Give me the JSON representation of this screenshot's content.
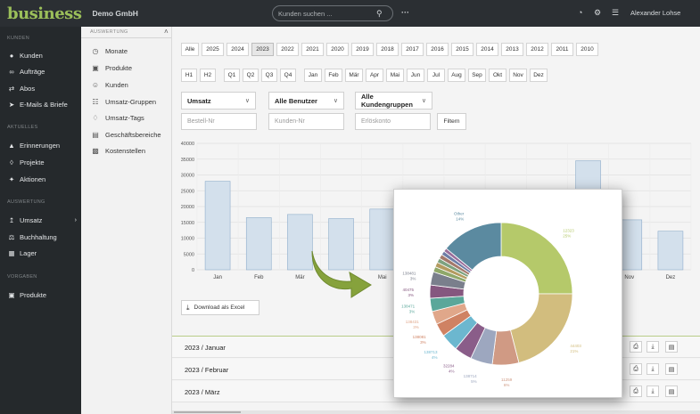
{
  "header": {
    "logo": "business",
    "company": "Demo GmbH",
    "search_placeholder": "Kunden suchen ...",
    "more": "···",
    "user": "Alexander Lohse"
  },
  "sidebar": {
    "sections": [
      {
        "title": "KUNDEN",
        "items": [
          "Kunden",
          "Aufträge",
          "Abos",
          "E-Mails & Briefe"
        ]
      },
      {
        "title": "AKTUELLES",
        "items": [
          "Erinnerungen",
          "Projekte",
          "Aktionen"
        ]
      },
      {
        "title": "AUSWERTUNG",
        "items": [
          "Umsatz",
          "Buchhaltung",
          "Lager"
        ]
      },
      {
        "title": "VORGABEN",
        "items": [
          "Produkte"
        ]
      }
    ]
  },
  "subnav": {
    "title": "AUSWERTUNG",
    "items": [
      "Monate",
      "Produkte",
      "Kunden",
      "Umsatz-Gruppen",
      "Umsatz-Tags",
      "Geschäftsbereiche",
      "Kostenstellen"
    ]
  },
  "years": [
    "Alle",
    "2025",
    "2024",
    "2023",
    "2022",
    "2021",
    "2020",
    "2019",
    "2018",
    "2017",
    "2016",
    "2015",
    "2014",
    "2013",
    "2012",
    "2011",
    "2010"
  ],
  "active_year": "2023",
  "periods": [
    "H1",
    "H2",
    "Q1",
    "Q2",
    "Q3",
    "Q4",
    "Jan",
    "Feb",
    "Mär",
    "Apr",
    "Mai",
    "Jun",
    "Jul",
    "Aug",
    "Sep",
    "Okt",
    "Nov",
    "Dez"
  ],
  "filters": {
    "metric": "Umsatz",
    "users": "Alle Benutzer",
    "groups": "Alle Kundengruppen",
    "order_placeholder": "Bestell-Nr",
    "customer_placeholder": "Kunden-Nr",
    "account_placeholder": "Erlöskonto",
    "filter_label": "Filtern"
  },
  "download_label": "Download als Excel",
  "month_rows": [
    "2023 / Januar",
    "2023 / Februar",
    "2023 / März"
  ],
  "chart_data": [
    {
      "type": "bar",
      "categories": [
        "Jan",
        "Feb",
        "Mär",
        "Apr",
        "Mai",
        "Jun",
        "Jul",
        "Aug",
        "Sep",
        "Okt",
        "Nov",
        "Dez"
      ],
      "category_labels": [
        "Jan",
        "Feb",
        "Mär",
        "",
        "Mai",
        "",
        "",
        "",
        "",
        "",
        "Nov",
        "Dez"
      ],
      "values": [
        28000,
        16500,
        17500,
        16200,
        19200,
        null,
        null,
        null,
        null,
        34500,
        15800,
        12200
      ],
      "ylim": [
        0,
        40000
      ],
      "yticks": [
        0,
        5000,
        10000,
        15000,
        20000,
        25000,
        30000,
        35000,
        40000
      ],
      "grid": true,
      "bar_color": "#d3e0ec",
      "bar_edge": "#8faecb"
    },
    {
      "type": "pie",
      "donut": true,
      "labeled_slices": [
        {
          "label": "12323",
          "pct": "25%",
          "value": 25,
          "color": "#b5c96a"
        },
        {
          "label": "44403",
          "pct": "21%",
          "value": 21,
          "color": "#d2bd7e"
        },
        {
          "label": "11259",
          "pct": "6%",
          "value": 6,
          "color": "#d09a84"
        },
        {
          "label": "138714",
          "pct": "5%",
          "value": 5,
          "color": "#9da7bf"
        },
        {
          "label": "32284",
          "pct": "4%",
          "value": 4,
          "color": "#8a5d89"
        },
        {
          "label": "138713",
          "pct": "4%",
          "value": 4,
          "color": "#6cb7cf"
        },
        {
          "label": "138081",
          "pct": "3%",
          "value": 3,
          "color": "#cf8263"
        },
        {
          "label": "138431",
          "pct": "3%",
          "value": 3,
          "color": "#e0a78a"
        },
        {
          "label": "138471",
          "pct": "3%",
          "value": 3,
          "color": "#5aa79a"
        },
        {
          "label": "40475",
          "pct": "3%",
          "value": 3,
          "color": "#85577f"
        },
        {
          "label": "138481",
          "pct": "3%",
          "value": 3,
          "color": "#7a7f8c"
        },
        {
          "label": "Other",
          "pct": "14%",
          "value": 14,
          "color": "#5b8aa0"
        }
      ],
      "small_slices": [
        {
          "value": 1.2,
          "color": "#8fa86a"
        },
        {
          "value": 1.1,
          "color": "#b49b60"
        },
        {
          "value": 1.0,
          "color": "#7da27f"
        },
        {
          "value": 1.0,
          "color": "#a4796b"
        },
        {
          "value": 0.9,
          "color": "#6e7da6"
        },
        {
          "value": 0.8,
          "color": "#9a6e9a"
        }
      ]
    }
  ]
}
